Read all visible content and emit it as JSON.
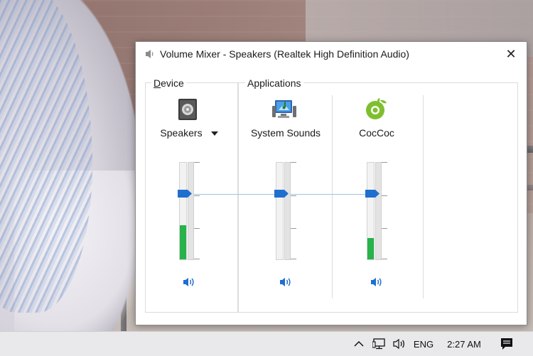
{
  "window": {
    "title": "Volume Mixer - Speakers (Realtek High Definition Audio)",
    "close_glyph": "✕"
  },
  "device_group": {
    "label_accel": "D",
    "label_rest": "evice"
  },
  "applications_group": {
    "label": "Applications"
  },
  "channels": [
    {
      "name": "Speakers",
      "icon": "speaker-device-icon",
      "volume_fraction": 0.67,
      "meter_level_fraction": 0.35,
      "has_dropdown": true
    },
    {
      "name": "System Sounds",
      "icon": "system-sounds-icon",
      "volume_fraction": 0.67,
      "meter_level_fraction": 0.0
    },
    {
      "name": "CocCoc",
      "icon": "coccoc-browser-icon",
      "volume_fraction": 0.67,
      "meter_level_fraction": 0.22
    }
  ],
  "taskbar": {
    "language": "ENG",
    "time": "2:27 AM"
  },
  "colors": {
    "thumb": "#1f6fcf",
    "meter_green": "#27b24a",
    "speaker_glyph": "#1f6fcf",
    "link_line": "#9fc3e6"
  }
}
